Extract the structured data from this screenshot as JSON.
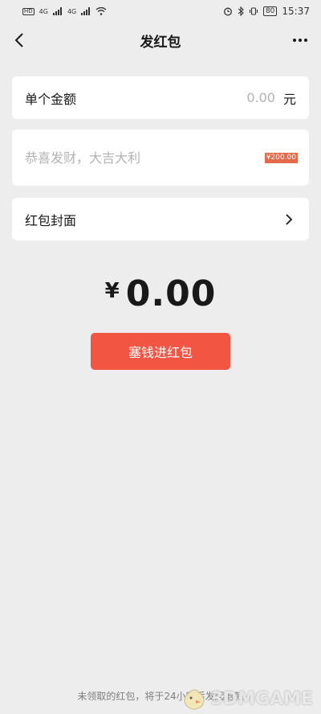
{
  "status_bar": {
    "hd1": "HD",
    "hd2": "HD",
    "signal1": "4G",
    "signal2": "4G",
    "battery": "80",
    "time": "15:37"
  },
  "nav": {
    "title": "发红包"
  },
  "amount": {
    "label": "单个金额",
    "value": "0.00",
    "unit": "元"
  },
  "greeting": {
    "placeholder": "恭喜发财，大吉大利",
    "emoji_chip": "¥200.00"
  },
  "cover": {
    "label": "红包封面"
  },
  "total": {
    "symbol": "¥",
    "value": "0.00"
  },
  "send_button": {
    "label": "塞钱进红包"
  },
  "footer": {
    "note": "未领取的红包，将于24小时后发起退款"
  },
  "watermark": {
    "text": "3DMGAME"
  },
  "colors": {
    "background": "#ededed",
    "button": "#f25542"
  }
}
